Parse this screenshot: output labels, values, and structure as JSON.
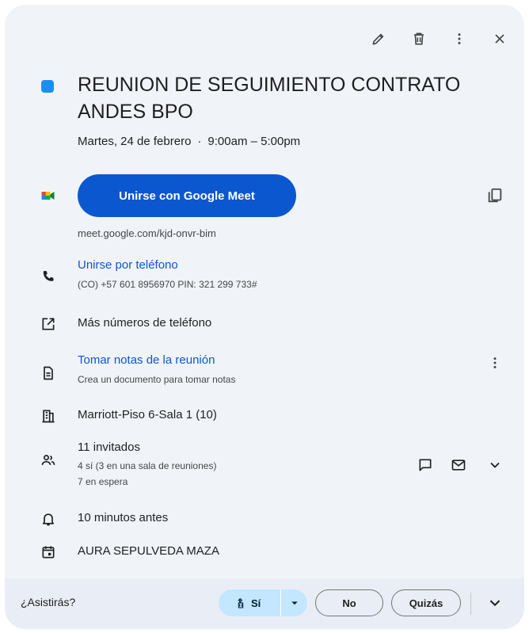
{
  "colors": {
    "accent": "#0b57d0",
    "event_dot": "#1a8ff0",
    "meet_btn_text": "#ffffff"
  },
  "toolbar": {
    "edit_icon": "pencil-icon",
    "delete_icon": "trash-icon",
    "more_icon": "more-vert-icon",
    "close_icon": "close-icon"
  },
  "event": {
    "title": "REUNION DE SEGUIMIENTO CONTRATO ANDES BPO",
    "date": "Martes, 24 de febrero",
    "separator": "·",
    "time": "9:00am – 5:00pm"
  },
  "meet": {
    "button_label": "Unirse con Google Meet",
    "link": "meet.google.com/kjd-onvr-bim",
    "icon": "google-meet-icon",
    "copy_icon": "copy-icon"
  },
  "phone": {
    "label": "Unirse por teléfono",
    "details": "(CO) +57 601 8956970 PIN: 321 299 733#",
    "icon": "phone-icon"
  },
  "more_numbers": {
    "label": "Más números de teléfono",
    "icon": "open-in-new-icon"
  },
  "notes": {
    "label": "Tomar notas de la reunión",
    "sub": "Crea un documento para tomar notas",
    "icon": "document-icon",
    "more_icon": "more-vert-icon"
  },
  "room": {
    "label": "Marriott-Piso 6-Sala 1 (10)",
    "icon": "building-icon"
  },
  "guests": {
    "label": "11 invitados",
    "yes_line": "4 sí (3 en una sala de reuniones)",
    "waiting_line": "7 en espera",
    "icon": "people-icon",
    "chat_icon": "chat-icon",
    "email_icon": "email-icon",
    "expand_icon": "chevron-down-icon"
  },
  "reminder": {
    "label": "10 minutos antes",
    "icon": "bell-icon"
  },
  "organizer": {
    "label": "AURA SEPULVEDA MAZA",
    "icon": "calendar-icon"
  },
  "footer": {
    "question": "¿Asistirás?",
    "yes_label": "Sí",
    "no_label": "No",
    "maybe_label": "Quizás",
    "yes_icon": "room-rsvp-icon",
    "dropdown_icon": "caret-down-icon",
    "expand_icon": "chevron-down-icon"
  }
}
